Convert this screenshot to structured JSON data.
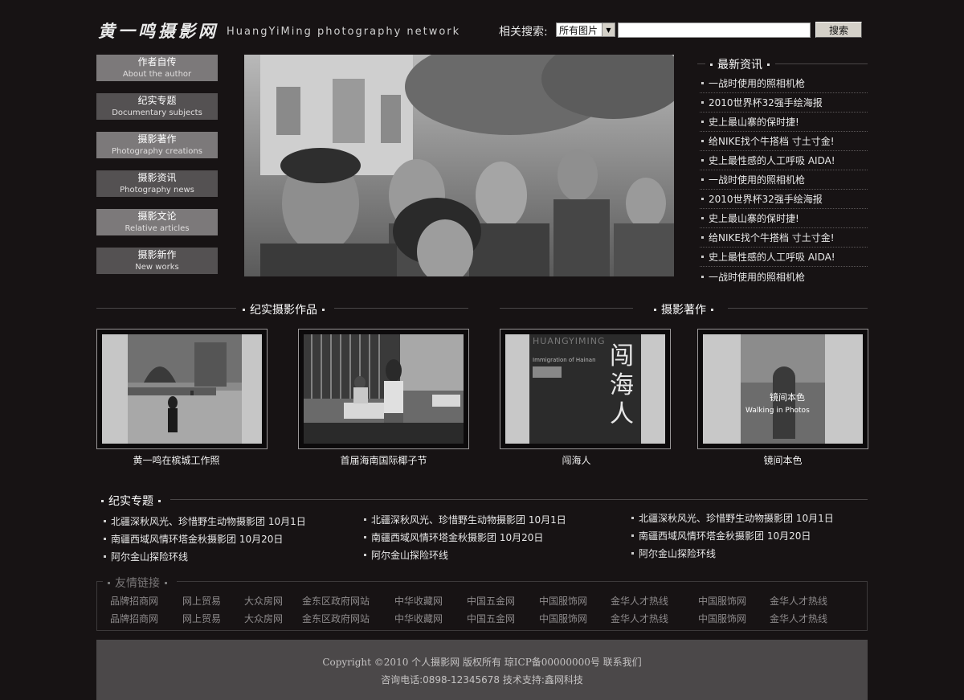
{
  "header": {
    "logo_cn": "黄一鸣摄影网",
    "logo_en": "HuangYiMing photography network",
    "search_label": "相关搜索:",
    "search_select_value": "所有图片",
    "search_button": "搜索"
  },
  "nav": [
    {
      "cn": "作者自传",
      "en": "About the author"
    },
    {
      "cn": "纪实专题",
      "en": "Documentary subjects"
    },
    {
      "cn": "摄影著作",
      "en": "Photography creations"
    },
    {
      "cn": "摄影资讯",
      "en": "Photography news"
    },
    {
      "cn": "摄影文论",
      "en": "Relative articles"
    },
    {
      "cn": "摄影新作",
      "en": "New works"
    }
  ],
  "news": {
    "title": "最新资讯",
    "items": [
      "一战时使用的照相机枪",
      "2010世界杯32强手绘海报",
      "史上最山寨的保时捷!",
      "给NIKE找个牛搭档 寸土寸金!",
      "史上最性感的人工呼吸 AIDA!",
      "一战时使用的照相机枪",
      "2010世界杯32强手绘海报",
      "史上最山寨的保时捷!",
      "给NIKE找个牛搭档 寸土寸金!",
      "史上最性感的人工呼吸 AIDA!",
      "一战时使用的照相机枪"
    ]
  },
  "works": {
    "doc_title": "纪实摄影作品",
    "book_title": "摄影著作",
    "items": [
      {
        "caption": "黄一鸣在槟城工作照"
      },
      {
        "caption": "首届海南国际椰子节"
      },
      {
        "caption": "闯海人",
        "book_en": "HUANGYIMING",
        "book_sub": "Immigration of Hainan",
        "book_cn": "闯海人"
      },
      {
        "caption": "镜间本色",
        "book_en": "Walking in Photos",
        "book_cn": "镜间本色"
      }
    ]
  },
  "documentary": {
    "title": "纪实专题",
    "columns": [
      [
        "北疆深秋风光、珍惜野生动物摄影团 10月1日",
        "南疆西域风情环塔金秋摄影团 10月20日",
        "阿尔金山探险环线"
      ],
      [
        "北疆深秋风光、珍惜野生动物摄影团 10月1日",
        "南疆西域风情环塔金秋摄影团 10月20日",
        "阿尔金山探险环线"
      ],
      [
        "北疆深秋风光、珍惜野生动物摄影团 10月1日",
        "南疆西域风情环塔金秋摄影团 10月20日",
        "阿尔金山探险环线"
      ]
    ]
  },
  "links": {
    "title": "友情链接",
    "rows": [
      [
        "品牌招商网",
        "网上贸易",
        "大众房网",
        "金东区政府网站",
        "中华收藏网",
        "中国五金网",
        "中国服饰网",
        "金华人才热线",
        "中国服饰网",
        "金华人才热线"
      ],
      [
        "品牌招商网",
        "网上贸易",
        "大众房网",
        "金东区政府网站",
        "中华收藏网",
        "中国五金网",
        "中国服饰网",
        "金华人才热线",
        "中国服饰网",
        "金华人才热线"
      ]
    ]
  },
  "footer": {
    "line1": "Copyright ©2010 个人摄影网 版权所有  琼ICP备00000000号  联系我们",
    "line2": "咨询电话:0898-12345678   技术支持:鑫网科技"
  }
}
